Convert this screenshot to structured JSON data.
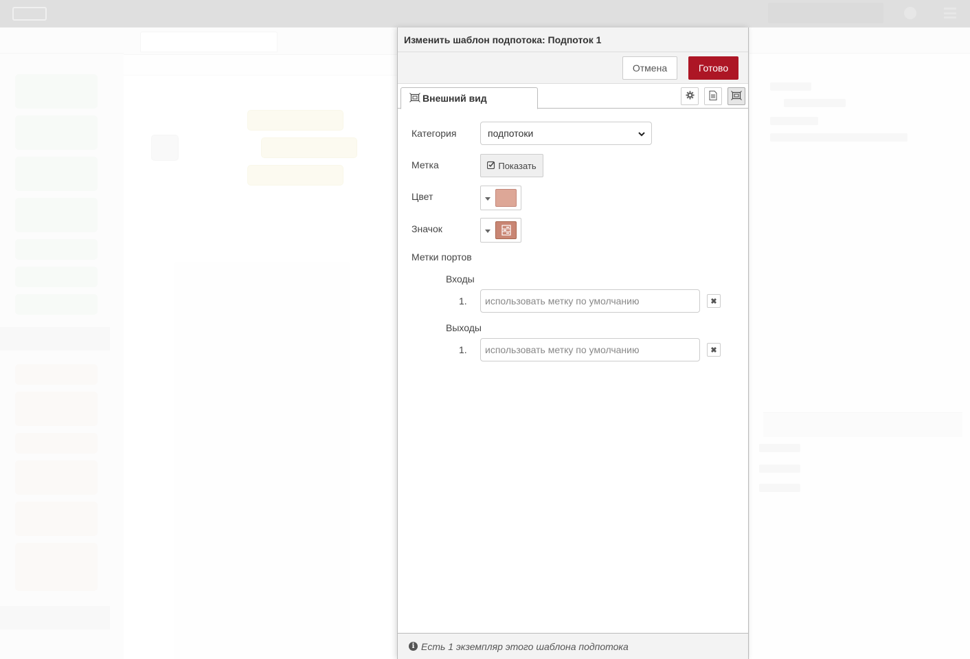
{
  "dialog": {
    "title": "Изменить шаблон подпотока: Подпоток 1",
    "cancel_label": "Отмена",
    "done_label": "Готово"
  },
  "tabs": [
    {
      "label": "Внешний вид",
      "icon": "node-appearance-icon",
      "active": true
    }
  ],
  "tab_icons": [
    "gear-icon",
    "document-icon",
    "node-appearance-icon"
  ],
  "form": {
    "category_label": "Категория",
    "category_value": "подпотоки",
    "label_label": "Метка",
    "label_toggle": "Показать",
    "color_label": "Цвет",
    "color_value": "#dda797",
    "icon_label": "Значок",
    "icon_name": "subflow-icon",
    "port_labels_title": "Метки портов",
    "inputs_label": "Входы",
    "outputs_label": "Выходы",
    "inputs": [
      {
        "num": "1.",
        "value": "",
        "placeholder": "использовать метку по умолчанию"
      }
    ],
    "outputs": [
      {
        "num": "1.",
        "value": "",
        "placeholder": "использовать метку по умолчанию"
      }
    ]
  },
  "footer": {
    "info_text": "Есть 1 экземпляр этого шаблона подпотока"
  },
  "colors": {
    "accent": "#ad1625",
    "node_color": "#dda797",
    "icon_bg": "#c98674"
  }
}
